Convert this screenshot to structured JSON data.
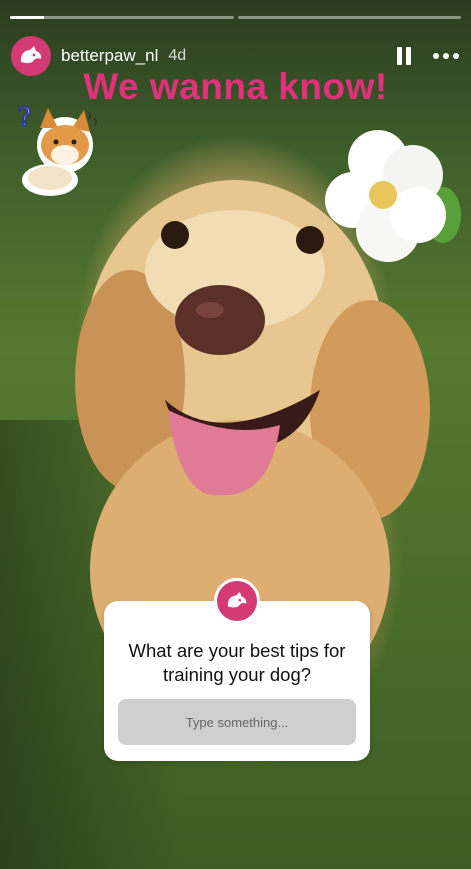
{
  "progress": [
    1,
    0
  ],
  "account": {
    "username": "betterpaw_nl",
    "age": "4d",
    "avatar_icon": "betterpaw-logo-icon"
  },
  "controls": {
    "pause_icon": "pause-icon",
    "more_icon": "more-options-icon"
  },
  "headline": "We wanna know!",
  "question_sticker": {
    "prompt": "What are your best tips for training your dog?",
    "placeholder": "Type something..."
  },
  "colors": {
    "brand": "#d43a73",
    "headline": "#e0317a"
  }
}
